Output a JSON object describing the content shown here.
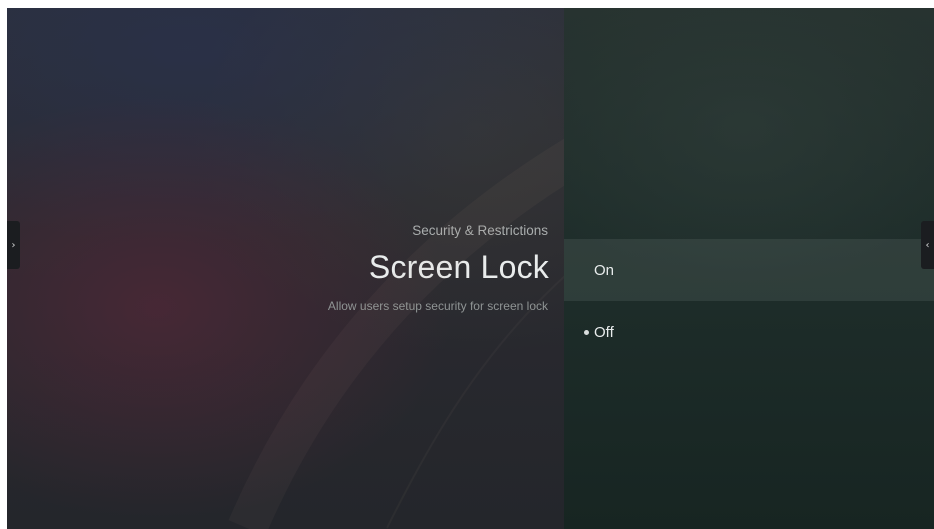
{
  "menu": {
    "breadcrumb": "Security & Restrictions",
    "title": "Screen Lock",
    "description": "Allow users setup security for screen lock"
  },
  "options": [
    {
      "label": "On",
      "focused": true,
      "selected": false
    },
    {
      "label": "Off",
      "focused": false,
      "selected": true
    }
  ],
  "edge_tabs": {
    "left_glyph": "›",
    "right_glyph": "‹"
  },
  "icons": {
    "left_tab": "chevron-right-icon",
    "right_tab": "chevron-left-icon",
    "selected_marker": "radio-selected-dot-icon"
  }
}
